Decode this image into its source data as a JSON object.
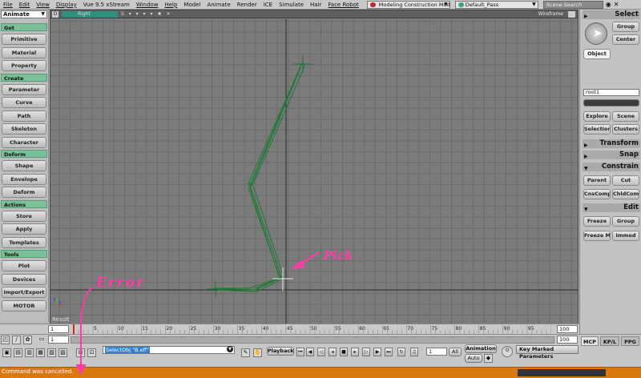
{
  "menubar": {
    "items": [
      "File",
      "Edit",
      "View",
      "Display",
      "Vue 9.5 xStream",
      "Window",
      "Help",
      "Model",
      "Animate",
      "Render",
      "ICE",
      "Simulate",
      "Hair",
      "Face Robot"
    ],
    "construction_mode": "Modeling Construction Mode",
    "pass": "Default_Pass",
    "search_placeholder": "Scene Search"
  },
  "left_panel": {
    "mode": "Animate",
    "sections": [
      {
        "header": "Get",
        "items": [
          "Primitive",
          "Material",
          "Property"
        ]
      },
      {
        "header": "Create",
        "items": [
          "Parameter",
          "Curve",
          "Path",
          "Skeleton",
          "Character"
        ]
      },
      {
        "header": "Deform",
        "items": [
          "Shape",
          "Envelope",
          "Deform"
        ]
      },
      {
        "header": "Actions",
        "items": [
          "Store",
          "Apply",
          "Templates"
        ]
      },
      {
        "header": "Tools",
        "items": [
          "Plot",
          "Devices",
          "Import/Export",
          "MOTOR"
        ]
      }
    ]
  },
  "viewport": {
    "camera": "Right",
    "view_icons": "S ▾ ▾ ▾ ▾ ♠ ✕",
    "display_mode": "Wireframe",
    "result_label": "Result",
    "axis_x": "x",
    "axis_y": "y"
  },
  "annotations": {
    "pick": "Pick",
    "error": "Error",
    "color": "#ff3ca6"
  },
  "right_panel": {
    "select_header": "Select",
    "group_btn": "Group",
    "center_btn": "Center",
    "object_btn": "Object",
    "name_field": "root1",
    "explore_btn": "Explore",
    "scene_btn": "Scene",
    "selection_btn": "Selection",
    "clusters_btn": "Clusters",
    "transform_header": "Transform",
    "snap_header": "Snap",
    "constrain_header": "Constrain",
    "parent_btn": "Parent",
    "cut_btn": "Cut",
    "cnscomp_btn": "CnsComp",
    "chldcomp_btn": "ChldComp",
    "edit_header": "Edit",
    "freeze_btn": "Freeze",
    "group2_btn": "Group",
    "freezem_btn": "Freeze M",
    "immed_btn": "Immed"
  },
  "timeline": {
    "start": "1",
    "start2": "1",
    "end": "100",
    "end2": "100",
    "ticks": [
      5,
      10,
      15,
      20,
      25,
      30,
      35,
      40,
      45,
      50,
      55,
      60,
      65,
      70,
      75,
      80,
      85,
      90,
      95
    ],
    "range_min": 1,
    "range_max": 100
  },
  "bottom_bar": {
    "command": "SelectObj \"B.eff\"",
    "playback_label": "Playback",
    "frame": "1",
    "all_label": "All",
    "animation_label": "Animation",
    "auto_label": "Auto",
    "key_marked": "Key Marked Parameters",
    "tabs": [
      "MCP",
      "KP/L",
      "PPG"
    ]
  },
  "status": {
    "message": "Command was cancelled.",
    "bar_color": "#d9780f"
  },
  "colors": {
    "accent_green": "#79c099",
    "skeleton": "#1e7a35",
    "viewport_bg": "#7b7b7b"
  }
}
